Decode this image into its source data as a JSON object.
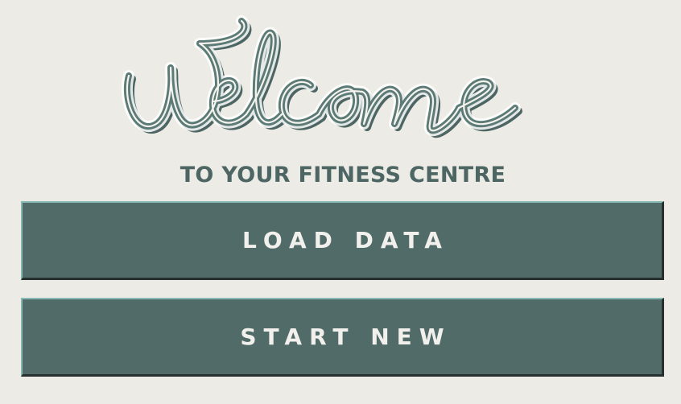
{
  "logo": {
    "text": "Welcome"
  },
  "subtitle": "TO YOUR FITNESS CENTRE",
  "buttons": {
    "load_label": "LOAD DATA",
    "start_label": "START NEW"
  },
  "colors": {
    "background": "#ecebe6",
    "accent": "#516b68",
    "accent_highlight": "#86b9b1",
    "accent_shadow": "#26302f",
    "button_text": "#f1f0ec"
  }
}
